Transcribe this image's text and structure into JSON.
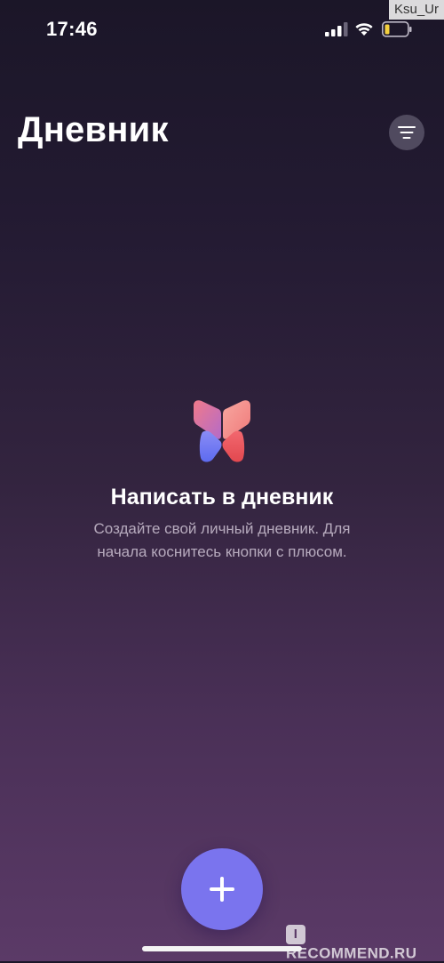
{
  "status_bar": {
    "time": "17:46",
    "icons": [
      "signal-icon",
      "wifi-icon",
      "battery-icon"
    ]
  },
  "watermark_user": "Ksu_Ur",
  "header": {
    "title": "Дневник",
    "filter_icon": "filter-lines-icon"
  },
  "empty_state": {
    "logo_icon": "butterfly-logo-icon",
    "title": "Написать в дневник",
    "description": "Создайте свой личный дневник. Для начала коснитесь кнопки с плюсом."
  },
  "add_button": {
    "icon": "plus-icon",
    "color": "#7a74ee"
  },
  "watermark_site": {
    "logo": "I",
    "text": "RECOMMEND.RU"
  },
  "colors": {
    "background_top": "#1b1628",
    "background_bottom": "#5b3a67",
    "accent": "#7a74ee"
  }
}
